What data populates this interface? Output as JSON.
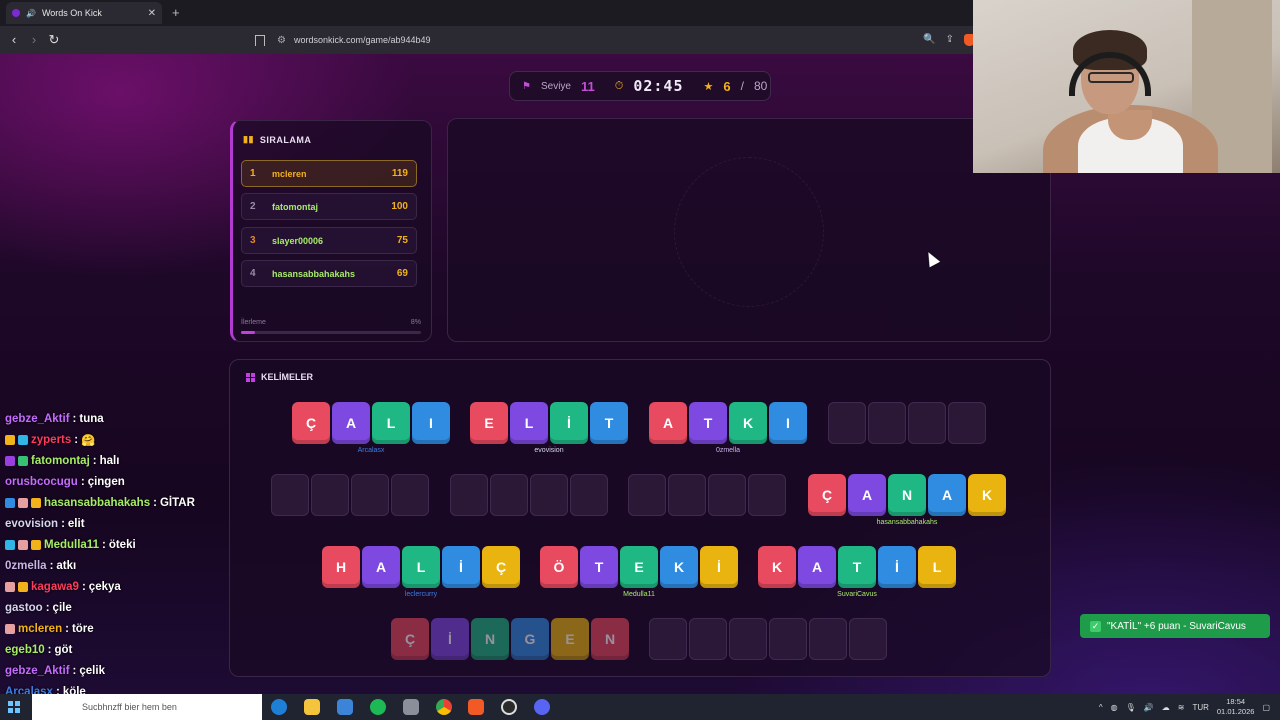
{
  "browser": {
    "tab_title": "Words On Kick",
    "tab_close": "✕",
    "new_tab": "+",
    "url": "wordsonkick.com/game/ab944b49",
    "back": "‹",
    "forward": "›",
    "reload": "↻"
  },
  "game": {
    "level_label": "Seviye",
    "level_value": "11",
    "timer": "02:45",
    "score": "6",
    "score_sep": "/",
    "score_total": "80"
  },
  "ranking": {
    "title": "SIRALAMA",
    "rows": [
      {
        "pos": "1",
        "name": "mcleren",
        "points": "119",
        "name_color": "#f2b21b"
      },
      {
        "pos": "2",
        "name": "fatomontaj",
        "points": "100",
        "name_color": "#a6ec66"
      },
      {
        "pos": "3",
        "name": "slayer00006",
        "points": "75",
        "name_color": "#a6ec66"
      },
      {
        "pos": "4",
        "name": "hasansabbahakahs",
        "points": "69",
        "name_color": "#a6ec66"
      }
    ],
    "progress_label": "İlerleme",
    "progress_value": "8%",
    "progress_fraction": 0.08
  },
  "words": {
    "title": "KELİMELER",
    "found": [
      {
        "letters": [
          "Ç",
          "A",
          "L",
          "I"
        ],
        "colors": [
          "red",
          "purple",
          "green",
          "blue"
        ],
        "owner": "Arcalasx",
        "owner_color": "#3d7de0"
      },
      {
        "letters": [
          "E",
          "L",
          "İ",
          "T"
        ],
        "colors": [
          "red",
          "purple",
          "green",
          "blue"
        ],
        "owner": "evovision",
        "owner_color": "#d8d4f0"
      },
      {
        "letters": [
          "A",
          "T",
          "K",
          "I"
        ],
        "colors": [
          "red",
          "purple",
          "green",
          "blue"
        ],
        "owner": "0zmella",
        "owner_color": "#c9b4e8"
      },
      {
        "letters": [
          "Ç",
          "A",
          "N",
          "A",
          "K"
        ],
        "colors": [
          "red",
          "purple",
          "green",
          "blue",
          "yellow"
        ],
        "owner": "hasansabbahakahs",
        "owner_color": "#a6ec66"
      },
      {
        "letters": [
          "H",
          "A",
          "L",
          "İ",
          "Ç"
        ],
        "colors": [
          "red",
          "purple",
          "green",
          "blue",
          "yellow"
        ],
        "owner": "leclercurry",
        "owner_color": "#3d7de0"
      },
      {
        "letters": [
          "Ö",
          "T",
          "E",
          "K",
          "İ"
        ],
        "colors": [
          "red",
          "purple",
          "green",
          "blue",
          "yellow"
        ],
        "owner": "Medulla11",
        "owner_color": "#a6ec66"
      },
      {
        "letters": [
          "K",
          "A",
          "T",
          "İ",
          "L"
        ],
        "colors": [
          "red",
          "purple",
          "green",
          "blue",
          "yellow"
        ],
        "owner": "SuvariCavus",
        "owner_color": "#a6ec66"
      },
      {
        "letters": [
          "Ç",
          "İ",
          "N",
          "G",
          "E",
          "N"
        ],
        "colors": [
          "red",
          "purple",
          "green",
          "blue",
          "yellow",
          "red"
        ],
        "owner": "",
        "owner_color": "#a6ec66"
      }
    ]
  },
  "toast": {
    "text": "\"KATİL\" +6 puan - SuvariCavus",
    "check": "✓"
  },
  "chat": [
    {
      "user": "gebze_Aktif",
      "color": "#c66bff",
      "msg": "tuna",
      "badges": []
    },
    {
      "user": "zyperts",
      "color": "#ff3b5c",
      "msg": "🤗",
      "badges": [
        "#f2b21b",
        "#2fb5e6"
      ]
    },
    {
      "user": "fatomontaj",
      "color": "#a6ec66",
      "msg": "halı",
      "badges": [
        "#9a3fe0",
        "#38c173"
      ]
    },
    {
      "user": "orusbcocugu",
      "color": "#c66bff",
      "msg": "çingen",
      "badges": []
    },
    {
      "user": "hasansabbahakahs",
      "color": "#a6ec66",
      "msg": "GİTAR",
      "badges": [
        "#2f8ce0",
        "#e6a0a0",
        "#f2b21b"
      ]
    },
    {
      "user": "evovision",
      "color": "#d8d4f0",
      "msg": "elit",
      "badges": []
    },
    {
      "user": "Medulla11",
      "color": "#a6ec66",
      "msg": "öteki",
      "badges": [
        "#2fb5e6",
        "#e6a0a0",
        "#f2b21b"
      ]
    },
    {
      "user": "0zmella",
      "color": "#c9b4e8",
      "msg": "atkı",
      "badges": []
    },
    {
      "user": "kagawa9",
      "color": "#ff3b5c",
      "msg": "çekya",
      "badges": [
        "#e6a0a0",
        "#f2b21b"
      ]
    },
    {
      "user": "gastoo",
      "color": "#d8d4f0",
      "msg": "çile",
      "badges": []
    },
    {
      "user": "mcleren",
      "color": "#f2b21b",
      "msg": "töre",
      "badges": [
        "#e6a0a0"
      ]
    },
    {
      "user": "egeb10",
      "color": "#a6ec66",
      "msg": "göt",
      "badges": []
    },
    {
      "user": "gebze_Aktif",
      "color": "#c66bff",
      "msg": "çelik",
      "badges": []
    },
    {
      "user": "Arcalasx",
      "color": "#3d7de0",
      "msg": "köle",
      "badges": []
    }
  ],
  "taskbar": {
    "search_placeholder": "Sucbhnzff bier hem ben",
    "lang": "TUR",
    "time": "18:54",
    "date": "01.01.2026"
  }
}
